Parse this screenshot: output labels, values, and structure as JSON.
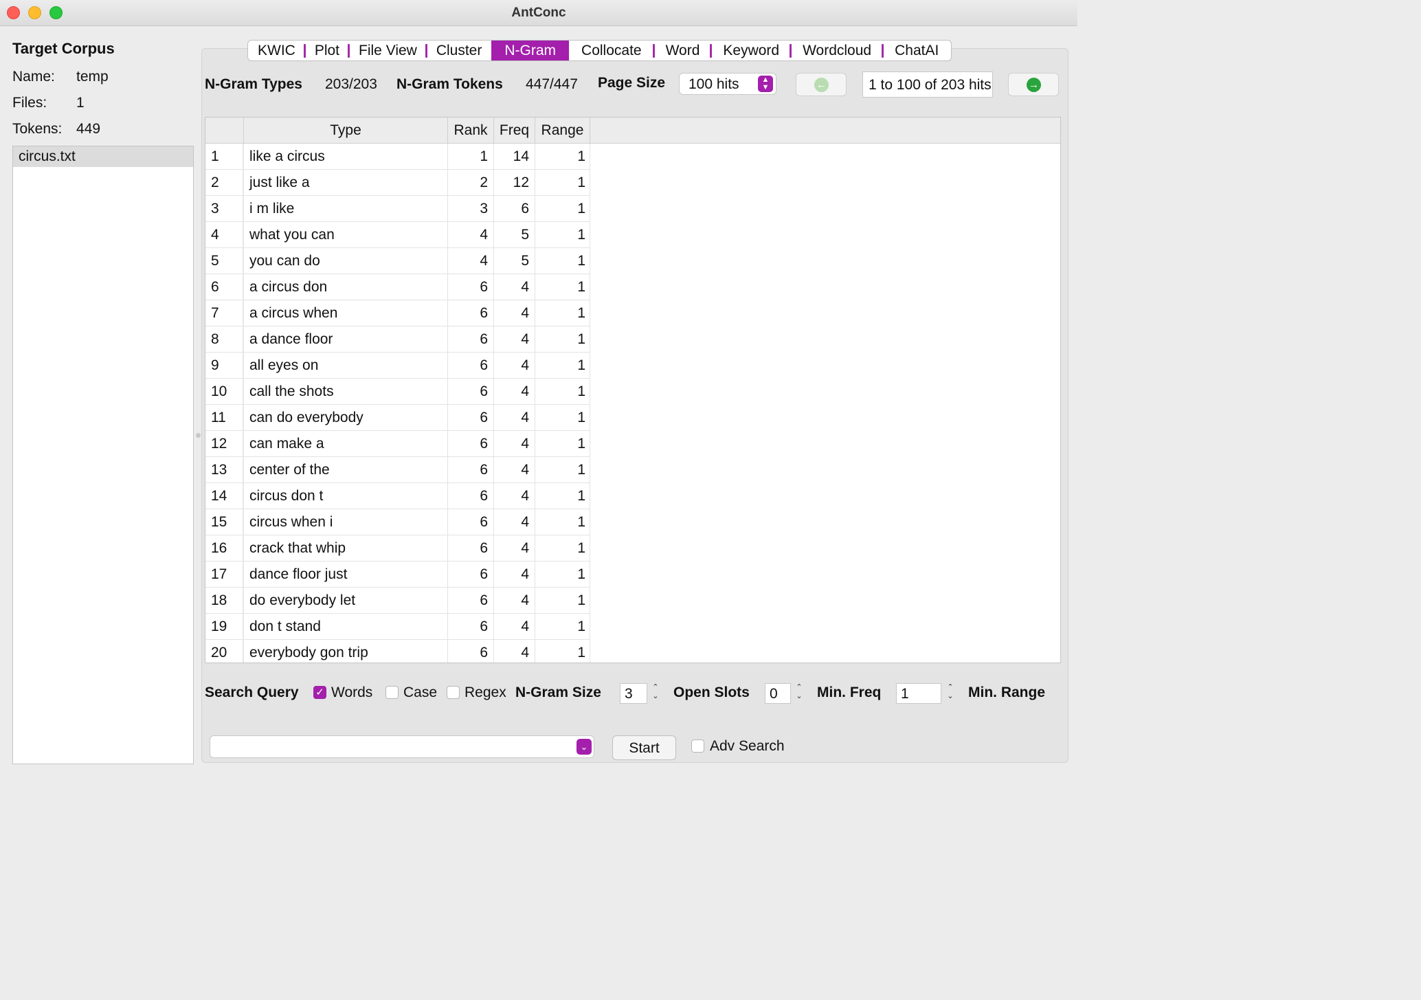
{
  "window": {
    "title": "AntConc"
  },
  "corpus": {
    "heading": "Target Corpus",
    "name_label": "Name:",
    "name_value": "temp",
    "files_label": "Files:",
    "files_value": "1",
    "tokens_label": "Tokens:",
    "tokens_value": "449",
    "files": [
      "circus.txt"
    ]
  },
  "tabs": [
    "KWIC",
    "Plot",
    "File View",
    "Cluster",
    "N-Gram",
    "Collocate",
    "Word",
    "Keyword",
    "Wordcloud",
    "ChatAI"
  ],
  "active_tab": "N-Gram",
  "toolbar": {
    "types_label": "N-Gram Types",
    "types_value": "203/203",
    "tokens_label": "N-Gram Tokens",
    "tokens_value": "447/447",
    "page_size_label": "Page Size",
    "page_size_value": "100 hits",
    "hits_range": "1 to 100 of 203 hits"
  },
  "table": {
    "headers": [
      "Type",
      "Rank",
      "Freq",
      "Range"
    ],
    "rows": [
      [
        "1",
        "like a circus",
        "1",
        "14",
        "1"
      ],
      [
        "2",
        "just like a",
        "2",
        "12",
        "1"
      ],
      [
        "3",
        "i m like",
        "3",
        "6",
        "1"
      ],
      [
        "4",
        "what you can",
        "4",
        "5",
        "1"
      ],
      [
        "5",
        "you can do",
        "4",
        "5",
        "1"
      ],
      [
        "6",
        "a circus don",
        "6",
        "4",
        "1"
      ],
      [
        "7",
        "a circus when",
        "6",
        "4",
        "1"
      ],
      [
        "8",
        "a dance floor",
        "6",
        "4",
        "1"
      ],
      [
        "9",
        "all eyes on",
        "6",
        "4",
        "1"
      ],
      [
        "10",
        "call the shots",
        "6",
        "4",
        "1"
      ],
      [
        "11",
        "can do everybody",
        "6",
        "4",
        "1"
      ],
      [
        "12",
        "can make a",
        "6",
        "4",
        "1"
      ],
      [
        "13",
        "center of the",
        "6",
        "4",
        "1"
      ],
      [
        "14",
        "circus don t",
        "6",
        "4",
        "1"
      ],
      [
        "15",
        "circus when i",
        "6",
        "4",
        "1"
      ],
      [
        "16",
        "crack that whip",
        "6",
        "4",
        "1"
      ],
      [
        "17",
        "dance floor just",
        "6",
        "4",
        "1"
      ],
      [
        "18",
        "do everybody let",
        "6",
        "4",
        "1"
      ],
      [
        "19",
        "don t stand",
        "6",
        "4",
        "1"
      ],
      [
        "20",
        "everybody gon trip",
        "6",
        "4",
        "1"
      ]
    ]
  },
  "search": {
    "query_label": "Search Query",
    "words_label": "Words",
    "words_checked": true,
    "case_label": "Case",
    "case_checked": false,
    "regex_label": "Regex",
    "regex_checked": false,
    "ngram_size_label": "N-Gram Size",
    "ngram_size_value": "3",
    "open_slots_label": "Open Slots",
    "open_slots_value": "0",
    "min_freq_label": "Min. Freq",
    "min_freq_value": "1",
    "min_range_label": "Min. Range",
    "query_value": "",
    "start_label": "Start",
    "adv_search_label": "Adv Search",
    "adv_search_checked": false
  },
  "colors": {
    "accent": "#a31fac",
    "nav_prev": "#b9dcb2",
    "nav_next": "#2aa43c"
  },
  "icons": {
    "prev": "arrow-left-circle-icon",
    "next": "arrow-right-circle-icon"
  }
}
